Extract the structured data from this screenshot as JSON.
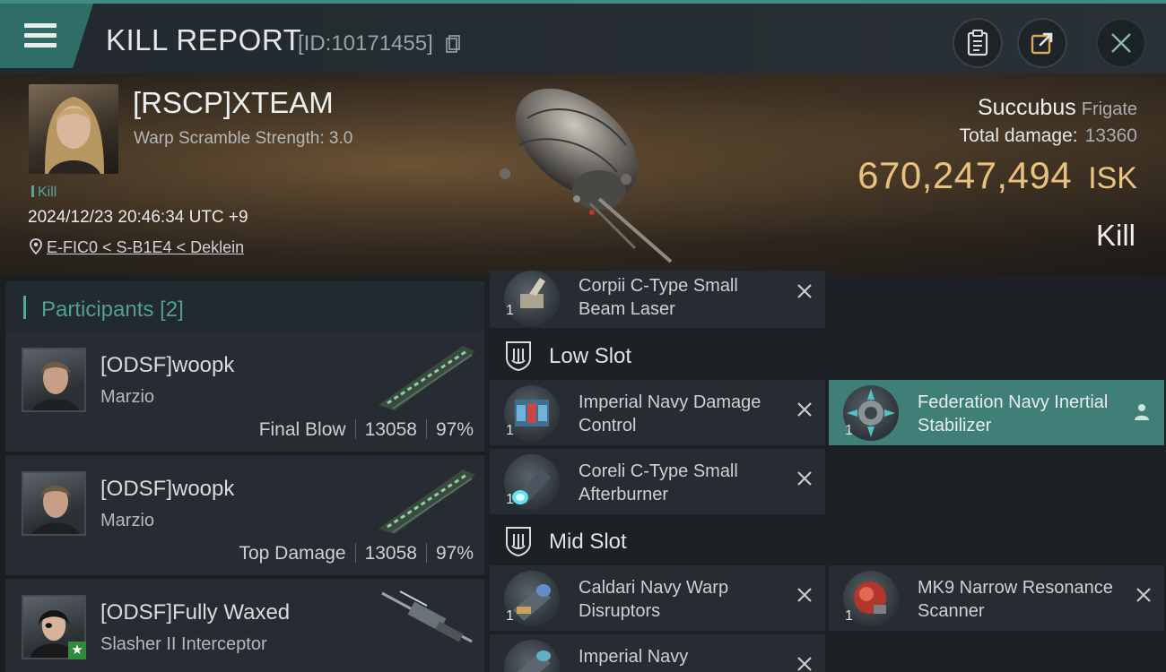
{
  "header": {
    "title": "KILL REPORT",
    "report_id": "[ID:10171455]",
    "buttons": [
      "clipboard-icon",
      "share-icon",
      "close-icon"
    ]
  },
  "victim": {
    "name": "[RSCP]XTEAM",
    "subtitle": "Warp Scramble Strength: 3.0",
    "tag": "Kill",
    "timestamp": "2024/12/23 20:46:34 UTC +9",
    "location": "E-FIC0 < S-B1E4 < Deklein",
    "ship_name": "Succubus",
    "ship_class": "Frigate",
    "total_damage_label": "Total damage:",
    "total_damage": "13360",
    "isk_value": "670,247,494",
    "isk_unit": "ISK",
    "result": "Kill"
  },
  "participants": {
    "title": "Participants",
    "count": "[2]",
    "rows": [
      {
        "name": "[ODSF]woopk",
        "ship": "Marzio",
        "label": "Final Blow",
        "damage": "13058",
        "percent": "97%"
      },
      {
        "name": "[ODSF]woopk",
        "ship": "Marzio",
        "label": "Top Damage",
        "damage": "13058",
        "percent": "97%"
      },
      {
        "name": "[ODSF]Fully Waxed",
        "ship": "Slasher II Interceptor",
        "label": "",
        "damage": "",
        "percent": ""
      }
    ]
  },
  "modules": {
    "high_tail": {
      "name": "Corpii C-Type Small Beam Laser",
      "qty": "1"
    },
    "low_slot": {
      "title": "Low Slot",
      "items": [
        {
          "name": "Imperial Navy Damage Control",
          "qty": "1"
        },
        {
          "name": "Federation Navy Inertial Stabilizer",
          "qty": "1"
        },
        {
          "name": "Coreli C-Type Small Afterburner",
          "qty": "1"
        }
      ]
    },
    "mid_slot": {
      "title": "Mid Slot",
      "items": [
        {
          "name": "Caldari Navy Warp Disruptors",
          "qty": "1"
        },
        {
          "name": "MK9 Narrow Resonance Scanner",
          "qty": "1"
        },
        {
          "name": "Imperial Navy",
          "qty": ""
        }
      ]
    }
  },
  "colors": {
    "accent": "#3e8c84",
    "isk": "#e8c27c",
    "highlight": "#3f7f78"
  }
}
